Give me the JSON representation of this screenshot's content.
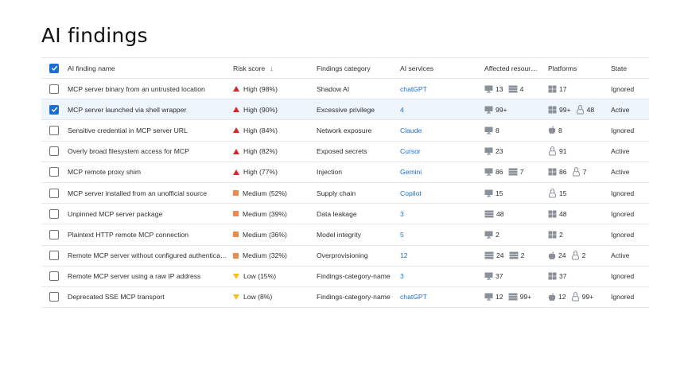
{
  "page": {
    "title": "AI findings"
  },
  "colors": {
    "accent": "#1a6fd1",
    "high": "#d8262c",
    "medium": "#f0894b",
    "low": "#f2c21b",
    "icon": "#8a9097"
  },
  "table": {
    "headers": {
      "name": "AI finding name",
      "risk": "Risk score",
      "category": "Findings category",
      "services": "AI services",
      "resources": "Affected resour…",
      "platforms": "Platforms",
      "state": "State"
    },
    "rows": [
      {
        "checked": false,
        "name": "MCP server binary from an untrusted location",
        "risk_level": "high",
        "risk": "High (98%)",
        "category": "Shadow AI",
        "service": "chatGPT",
        "resources": [
          {
            "icon": "monitor-icon",
            "count": "13"
          },
          {
            "icon": "server-icon",
            "count": "4"
          }
        ],
        "platforms": [
          {
            "icon": "windows-icon",
            "count": "17"
          }
        ],
        "state": "Ignored"
      },
      {
        "checked": true,
        "name": "MCP server launched via shell wrapper",
        "risk_level": "high",
        "risk": "High (90%)",
        "category": "Excessive privilege",
        "service": "4",
        "resources": [
          {
            "icon": "monitor-icon",
            "count": "99+"
          }
        ],
        "platforms": [
          {
            "icon": "windows-icon",
            "count": "99+"
          },
          {
            "icon": "linux-icon",
            "count": "48"
          }
        ],
        "state": "Active"
      },
      {
        "checked": false,
        "name": "Sensitive credential in MCP server URL",
        "risk_level": "high",
        "risk": "High (84%)",
        "category": "Network exposure",
        "service": "Claude",
        "resources": [
          {
            "icon": "monitor-icon",
            "count": "8"
          }
        ],
        "platforms": [
          {
            "icon": "apple-icon",
            "count": "8"
          }
        ],
        "state": "Ignored"
      },
      {
        "checked": false,
        "name": "Overly broad filesystem access for MCP",
        "risk_level": "high",
        "risk": "High (82%)",
        "category": "Exposed secrets",
        "service": "Cursor",
        "resources": [
          {
            "icon": "monitor-icon",
            "count": "23"
          }
        ],
        "platforms": [
          {
            "icon": "linux-icon",
            "count": "91"
          }
        ],
        "state": "Active"
      },
      {
        "checked": false,
        "name": "MCP remote proxy shim",
        "risk_level": "high",
        "risk": "High (77%)",
        "category": "Injection",
        "service": "Gemini",
        "resources": [
          {
            "icon": "monitor-icon",
            "count": "86"
          },
          {
            "icon": "server-icon",
            "count": "7"
          }
        ],
        "platforms": [
          {
            "icon": "windows-icon",
            "count": "86"
          },
          {
            "icon": "linux-icon",
            "count": "7"
          }
        ],
        "state": "Active"
      },
      {
        "checked": false,
        "name": "MCP server installed from an unofficial source",
        "risk_level": "medium",
        "risk": "Medium (52%)",
        "category": "Supply chain",
        "service": "Copilot",
        "resources": [
          {
            "icon": "monitor-icon",
            "count": "15"
          }
        ],
        "platforms": [
          {
            "icon": "linux-icon",
            "count": "15"
          }
        ],
        "state": "Ignored"
      },
      {
        "checked": false,
        "name": "Unpinned MCP server package",
        "risk_level": "medium",
        "risk": "Medium (39%)",
        "category": "Data leakage",
        "service": "3",
        "resources": [
          {
            "icon": "server-icon",
            "count": "48"
          }
        ],
        "platforms": [
          {
            "icon": "windows-icon",
            "count": "48"
          }
        ],
        "state": "Ignored"
      },
      {
        "checked": false,
        "name": "Plaintext HTTP remote MCP connection",
        "risk_level": "medium",
        "risk": "Medium (36%)",
        "category": "Model integrity",
        "service": "5",
        "resources": [
          {
            "icon": "monitor-icon",
            "count": "2"
          }
        ],
        "platforms": [
          {
            "icon": "windows-icon",
            "count": "2"
          }
        ],
        "state": "Ignored"
      },
      {
        "checked": false,
        "name": "Remote MCP server without configured authentica…",
        "risk_level": "medium",
        "risk": "Medium (32%)",
        "category": "Overprovisioning",
        "service": "12",
        "resources": [
          {
            "icon": "server-icon",
            "count": "24"
          },
          {
            "icon": "server-icon",
            "count": "2"
          }
        ],
        "platforms": [
          {
            "icon": "apple-icon",
            "count": "24"
          },
          {
            "icon": "linux-icon",
            "count": "2"
          }
        ],
        "state": "Active"
      },
      {
        "checked": false,
        "name": "Remote MCP server using a raw IP address",
        "risk_level": "low",
        "risk": "Low (15%)",
        "category": "Findings-category-name",
        "service": "3",
        "resources": [
          {
            "icon": "monitor-icon",
            "count": "37"
          }
        ],
        "platforms": [
          {
            "icon": "windows-icon",
            "count": "37"
          }
        ],
        "state": "Ignored"
      },
      {
        "checked": false,
        "name": "Deprecated SSE MCP transport",
        "risk_level": "low",
        "risk": "Low (8%)",
        "category": "Findings-category-name",
        "service": "chatGPT",
        "resources": [
          {
            "icon": "monitor-icon",
            "count": "12"
          },
          {
            "icon": "server-icon",
            "count": "99+"
          }
        ],
        "platforms": [
          {
            "icon": "apple-icon",
            "count": "12"
          },
          {
            "icon": "linux-icon",
            "count": "99+"
          }
        ],
        "state": "Ignored"
      }
    ]
  }
}
